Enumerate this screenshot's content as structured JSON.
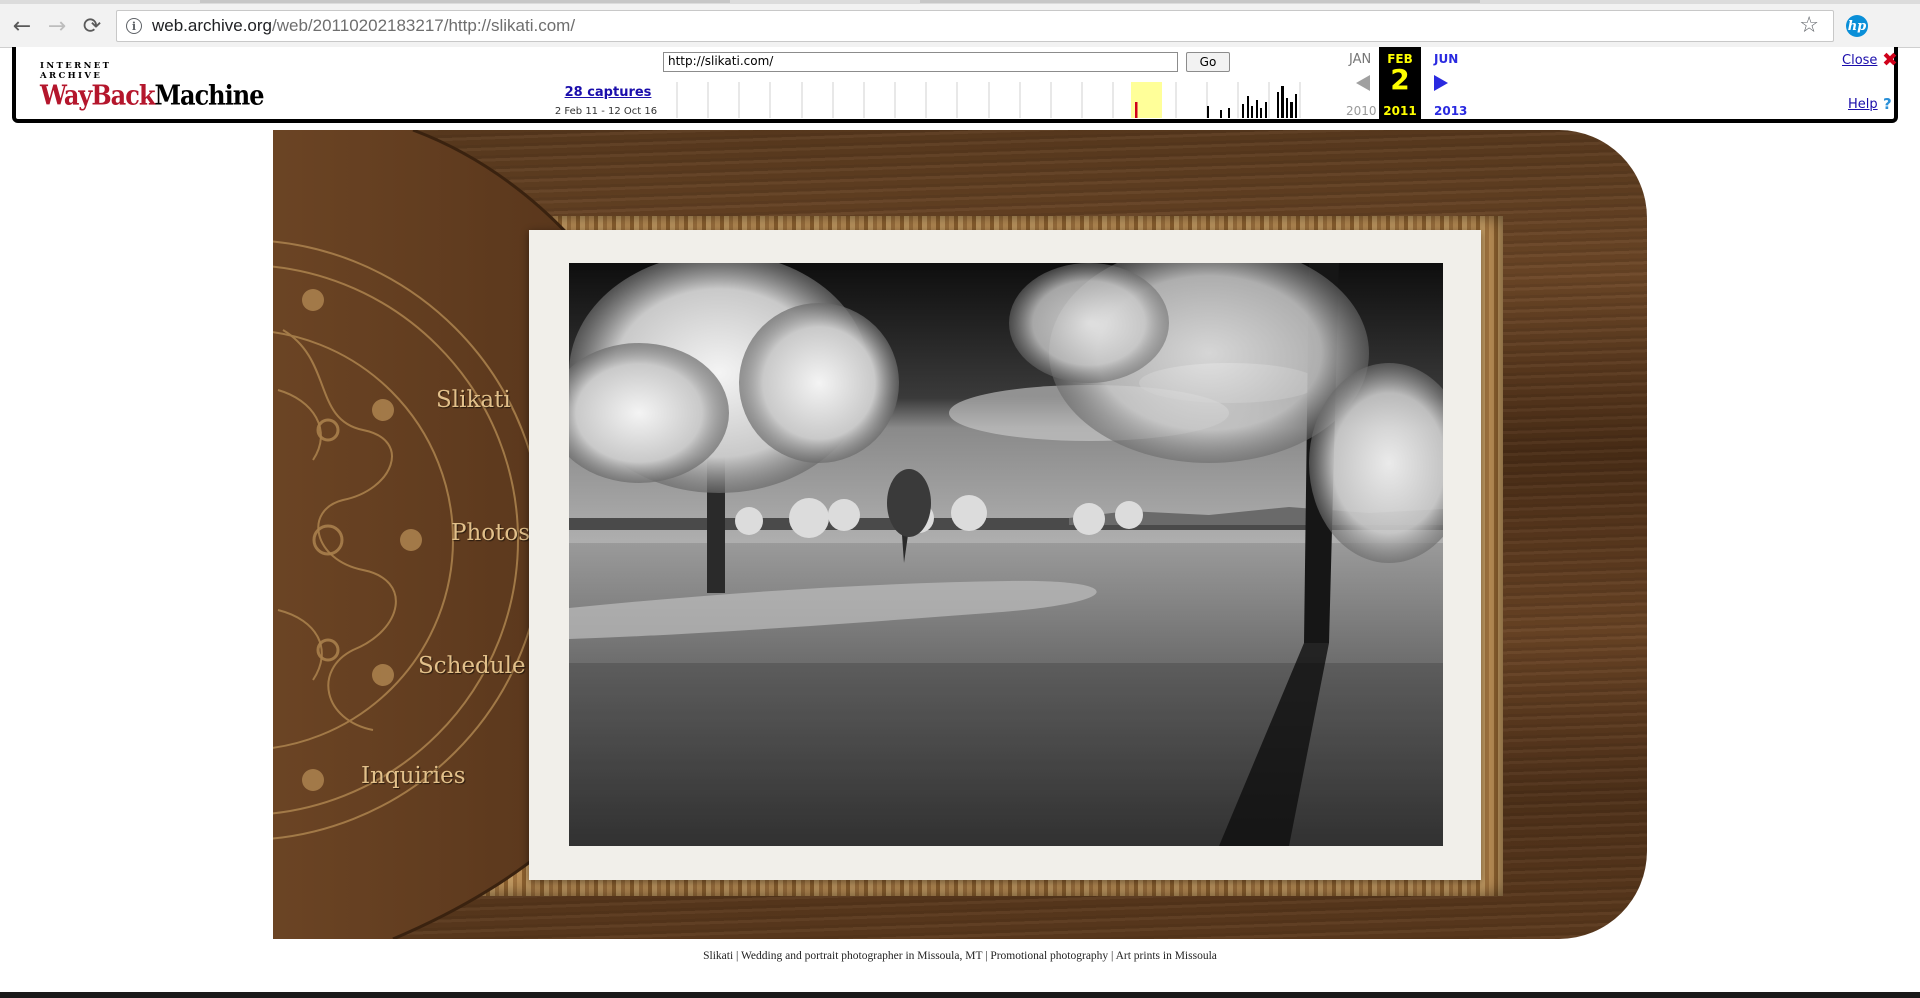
{
  "browser": {
    "url_host": "web.archive.org",
    "url_path": "/web/20110202183217/http://slikati.com/",
    "back_icon": "←",
    "forward_icon": "→",
    "reload_icon": "⟳",
    "star_icon": "☆",
    "extension_label": "hp"
  },
  "wayback": {
    "logo_top": "INTERNET ARCHIVE",
    "logo_way": "WayBack",
    "logo_machine": "Machine",
    "search_value": "http://slikati.com/",
    "go_label": "Go",
    "captures_label": "28 captures",
    "captures_range": "2 Feb 11 - 12 Oct 16",
    "prev_month": "JAN",
    "current_month": "FEB",
    "next_month": "JUN",
    "current_day": "2",
    "prev_year": "2010",
    "current_year": "2011",
    "next_year": "2013",
    "close_label": "Close",
    "close_icon": "✖",
    "help_label": "Help",
    "help_icon": "?"
  },
  "site": {
    "nav": [
      "Slikati",
      "Photos",
      "Schedule",
      "Inquiries"
    ]
  },
  "footer": {
    "text": "Slikati | Wedding and portrait photographer in Missoula, MT | Promotional photography | Art prints in Missoula"
  }
}
